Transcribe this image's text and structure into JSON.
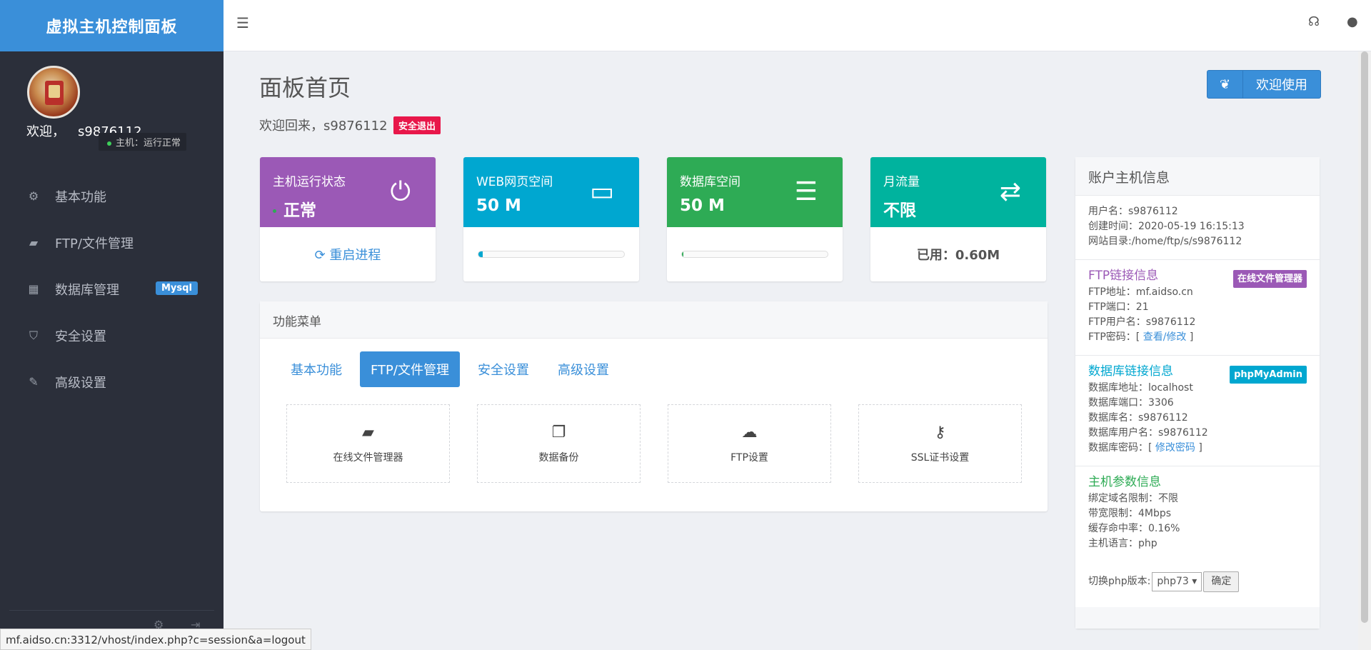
{
  "sidebar": {
    "brand": "虚拟主机控制面板",
    "welcome": "欢迎，",
    "username": "s9876112",
    "host_status": "主机：运行正常",
    "items": [
      {
        "label": "基本功能",
        "icon": "gears-icon",
        "glyph": "⚙"
      },
      {
        "label": "FTP/文件管理",
        "icon": "folder-open-icon",
        "glyph": "▰"
      },
      {
        "label": "数据库管理",
        "icon": "table-icon",
        "glyph": "▦",
        "badge": "Mysql"
      },
      {
        "label": "安全设置",
        "icon": "shield-icon",
        "glyph": "⛉"
      },
      {
        "label": "高级设置",
        "icon": "edit-icon",
        "glyph": "✎"
      }
    ]
  },
  "page": {
    "title": "面板首页",
    "welcome_back": "欢迎回来，s9876112",
    "logout": "安全退出",
    "welcome_button": "欢迎使用"
  },
  "cards": [
    {
      "title": "主机运行状态",
      "value": "正常",
      "action": "重启进程",
      "color": "#9b59b6"
    },
    {
      "title": "WEB网页空间",
      "value": "50 M",
      "usage_fraction": 0.03,
      "color": "#00a7d0"
    },
    {
      "title": "数据库空间",
      "value": "50 M",
      "usage_fraction": 0.01,
      "color": "#2eab55"
    },
    {
      "title": "月流量",
      "value": "不限",
      "used": "已用：0.60M",
      "color": "#00b39e"
    }
  ],
  "menu": {
    "header": "功能菜单",
    "tabs": [
      "基本功能",
      "FTP/文件管理",
      "安全设置",
      "高级设置"
    ],
    "active_tab": "FTP/文件管理",
    "tiles": [
      {
        "label": "在线文件管理器",
        "icon": "folder-open-icon"
      },
      {
        "label": "数据备份",
        "icon": "copy-icon"
      },
      {
        "label": "FTP设置",
        "icon": "cloud-upload-icon"
      },
      {
        "label": "SSL证书设置",
        "icon": "key-icon"
      }
    ]
  },
  "info": {
    "header": "账户主机信息",
    "account": [
      "用户名：s9876112",
      "创建时间：2020-05-19 16:15:13",
      "网站目录:/home/ftp/s/s9876112"
    ],
    "ftp": {
      "title": "FTP链接信息",
      "tag": "在线文件管理器",
      "lines": [
        "FTP地址：mf.aidso.cn",
        "FTP端口：21",
        "FTP用户名：s9876112"
      ],
      "pwd_label": "FTP密码：[ ",
      "pwd_link": "查看/修改",
      "pwd_end": " ]"
    },
    "db": {
      "title": "数据库链接信息",
      "tag": "phpMyAdmin",
      "lines": [
        "数据库地址：localhost",
        "数据库端口：3306",
        "数据库名：s9876112",
        "数据库用户名：s9876112"
      ],
      "pwd_label": "数据库密码：[ ",
      "pwd_link": "修改密码",
      "pwd_end": " ]"
    },
    "params": {
      "title": "主机参数信息",
      "lines": [
        "绑定域名限制：不限",
        "带宽限制：4Mbps",
        "缓存命中率：0.16%",
        "主机语言：php"
      ],
      "php_label": "切换php版本:",
      "php_value": "php73 ▾",
      "confirm": "确定"
    }
  },
  "status_url": "mf.aidso.cn:3312/vhost/index.php?c=session&a=logout"
}
